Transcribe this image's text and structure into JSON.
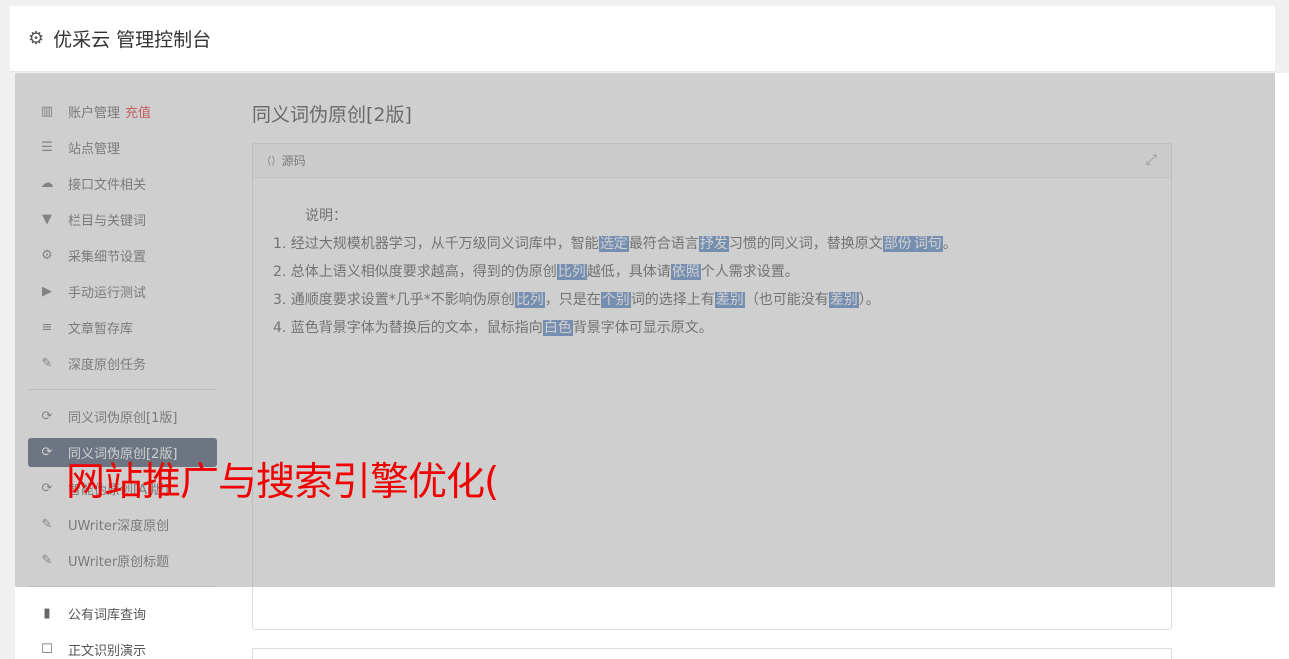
{
  "header": {
    "title": "优采云 管理控制台",
    "icon": "gear-icon"
  },
  "sidebar": {
    "groups": [
      [
        {
          "icon": "bar-chart-icon",
          "glyph": "▥",
          "label": "账户管理",
          "badge": "充值"
        },
        {
          "icon": "server-icon",
          "glyph": "☰",
          "label": "站点管理"
        },
        {
          "icon": "cloud-upload-icon",
          "glyph": "☁",
          "label": "接口文件相关"
        },
        {
          "icon": "filter-icon",
          "glyph": "▼",
          "label": "栏目与关键词"
        },
        {
          "icon": "cogs-icon",
          "glyph": "⚙",
          "label": "采集细节设置"
        },
        {
          "icon": "play-icon",
          "glyph": "▶",
          "label": "手动运行测试"
        },
        {
          "icon": "database-icon",
          "glyph": "≡",
          "label": "文章暂存库"
        },
        {
          "icon": "edit-icon",
          "glyph": "✎",
          "label": "深度原创任务"
        }
      ],
      [
        {
          "icon": "refresh-icon",
          "glyph": "⟳",
          "label": "同义词伪原创[1版]"
        },
        {
          "icon": "refresh-icon",
          "glyph": "⟳",
          "label": "同义词伪原创[2版]",
          "active": true
        },
        {
          "icon": "refresh-icon",
          "glyph": "⟳",
          "label": "智能伪原创[AI版]"
        },
        {
          "icon": "edit-icon",
          "glyph": "✎",
          "label": "UWriter深度原创"
        },
        {
          "icon": "edit-icon",
          "glyph": "✎",
          "label": "UWriter原创标题"
        }
      ],
      [
        {
          "icon": "book-icon",
          "glyph": "▮",
          "label": "公有词库查询"
        },
        {
          "icon": "checkbox-icon",
          "glyph": "☐",
          "label": "正文识别演示"
        }
      ]
    ]
  },
  "main": {
    "title": "同义词伪原创[2版]",
    "panel": {
      "header_label": "源码",
      "header_icon": "code-file-icon",
      "expand_icon": "expand-icon",
      "intro": "说明：",
      "lines": [
        [
          {
            "t": "1. 经过大规模机器学习，从千万级同义词库中，智能"
          },
          {
            "t": "选定",
            "h": true
          },
          {
            "t": "最符合语言"
          },
          {
            "t": "抒发",
            "h": true
          },
          {
            "t": "习惯的同义词，替换原文"
          },
          {
            "t": "部份",
            "h": true
          },
          {
            "t": "词句",
            "h": true
          },
          {
            "t": "。"
          }
        ],
        [
          {
            "t": "2. 总体上语义相似度要求越高，得到的伪原创"
          },
          {
            "t": "比列",
            "h": true
          },
          {
            "t": "越低，具体请"
          },
          {
            "t": "依照",
            "h": true
          },
          {
            "t": "个人需求设置。"
          }
        ],
        [
          {
            "t": "3. 通顺度要求设置*几乎*不影响伪原创"
          },
          {
            "t": "比列",
            "h": true
          },
          {
            "t": "，只是在"
          },
          {
            "t": "个别",
            "h": true
          },
          {
            "t": "词的选择上有"
          },
          {
            "t": "差别",
            "h": true
          },
          {
            "t": "（也可能没有"
          },
          {
            "t": "差别",
            "h": true
          },
          {
            "t": "）。"
          }
        ],
        [
          {
            "t": "4. 蓝色背景字体为替换后的文本，鼠标指向"
          },
          {
            "t": "白色",
            "h": true
          },
          {
            "t": "背景字体可显示原文。"
          }
        ]
      ]
    }
  },
  "watermark": {
    "text": "网站推广与搜索引擎优化("
  },
  "colors": {
    "highlight": "#4d7fc2",
    "active_nav": "#3a4a66",
    "badge": "#e02020",
    "watermark": "#f00000"
  }
}
